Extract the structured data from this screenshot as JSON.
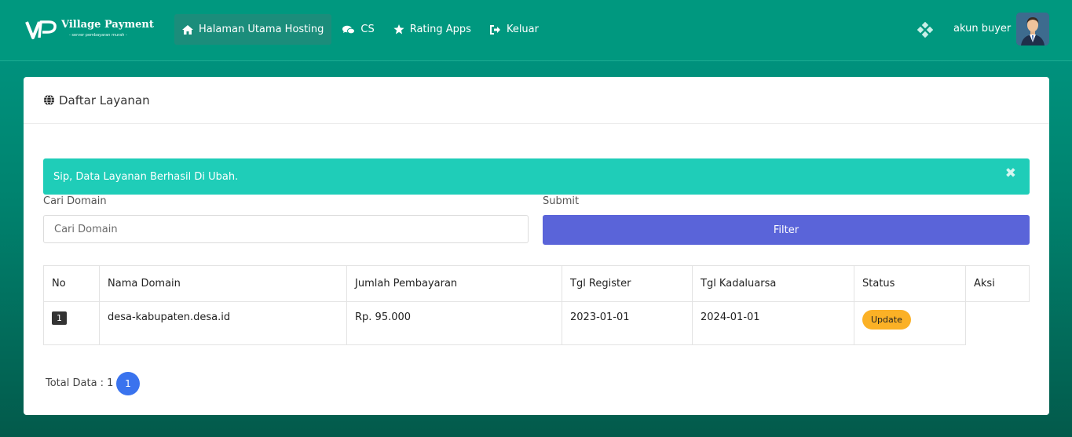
{
  "header": {
    "brand": "Village Payment",
    "tagline": "- server pembayaran murah -",
    "nav": [
      {
        "label": "Halaman Utama Hosting",
        "icon": "home-icon"
      },
      {
        "label": "CS",
        "icon": "chat-icon"
      },
      {
        "label": "Rating Apps",
        "icon": "star-icon"
      },
      {
        "label": "Keluar",
        "icon": "sign-out-icon"
      }
    ],
    "username": "akun buyer"
  },
  "card": {
    "title": "Daftar Layanan"
  },
  "alert": {
    "message": "Sip, Data Layanan Berhasil Di Ubah.",
    "close": "✖"
  },
  "search": {
    "label": "Cari Domain",
    "placeholder": "Cari Domain"
  },
  "submit": {
    "label": "Submit",
    "button": "Filter"
  },
  "table": {
    "headers": [
      "No",
      "Nama Domain",
      "Jumlah Pembayaran",
      "Tgl Register",
      "Tgl Kadaluarsa",
      "Status",
      "Aksi"
    ],
    "rows": [
      {
        "no": "1",
        "domain": "desa-kabupaten.desa.id",
        "amount": "Rp. 95.000",
        "registered": "2023-01-01",
        "expires": "2024-01-01",
        "status": "Update"
      }
    ]
  },
  "footer": {
    "total": "Total Data : 1",
    "page": "1"
  },
  "colors": {
    "header_bg": "#00987f",
    "alert_bg": "#1fcdb8",
    "filter_button": "#5a64d9",
    "status_badge": "#fbb126",
    "page_button": "#3a73ee"
  }
}
